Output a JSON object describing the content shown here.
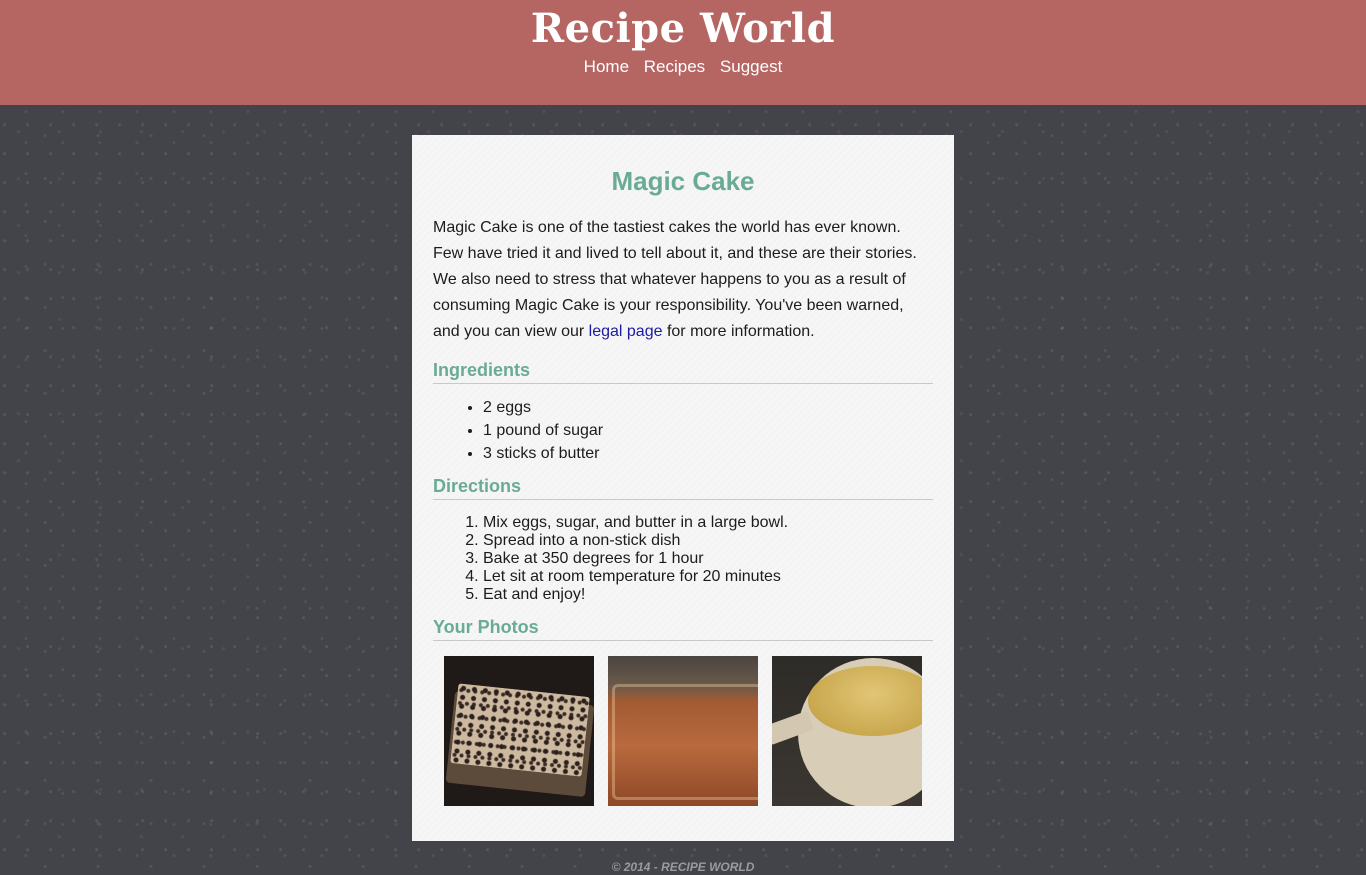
{
  "header": {
    "site_title": "Recipe World",
    "nav": [
      {
        "label": "Home"
      },
      {
        "label": "Recipes"
      },
      {
        "label": "Suggest"
      }
    ]
  },
  "recipe": {
    "title": "Magic Cake",
    "intro_text": "Magic Cake is one of the tastiest cakes the world has ever known. Few have tried it and lived to tell about it, and these are their stories. We also need to stress that whatever happens to you as a result of consuming Magic Cake is your responsibility. You've been warned, and you can view our",
    "intro_link": "legal page",
    "intro_suffix": "for more information.",
    "ingredients_heading": "Ingredients",
    "ingredients": [
      "2 eggs",
      "1 pound of sugar",
      "3 sticks of butter"
    ],
    "directions_heading": "Directions",
    "directions": [
      "Mix eggs, sugar, and butter in a large bowl.",
      "Spread into a non-stick dish",
      "Bake at 350 degrees for 1 hour",
      "Let sit at room temperature for 20 minutes",
      "Eat and enjoy!"
    ],
    "photos_heading": "Your Photos"
  },
  "footer": {
    "text": "© 2014 - RECIPE WORLD"
  },
  "colors": {
    "header_bg": "#b56663",
    "page_bg": "#43434a",
    "accent": "#6aab95",
    "link": "#1a1aa6"
  }
}
